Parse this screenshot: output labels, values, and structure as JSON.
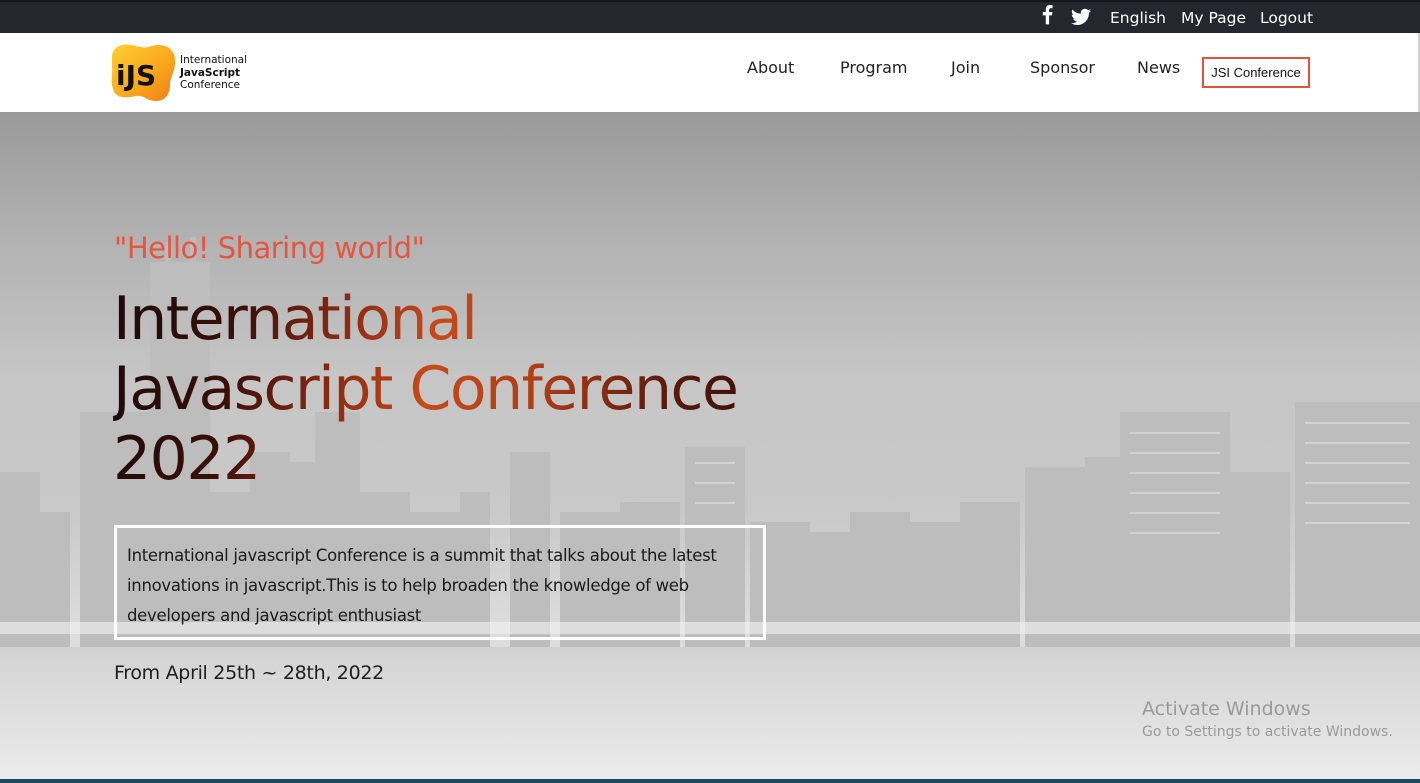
{
  "topbar": {
    "social_icons": [
      "facebook-icon",
      "twitter-icon"
    ],
    "language": "English",
    "my_page": "My Page",
    "logout": "Logout"
  },
  "header": {
    "logo": {
      "mark": "iJS",
      "line1": "International",
      "line2": "JavaScript",
      "line3": "Conference"
    },
    "nav": {
      "about": "About",
      "program": "Program",
      "join": "Join",
      "sponsor": "Sponsor",
      "news": "News",
      "jsi_conference": "JSI Conference"
    }
  },
  "hero": {
    "tagline": "\"Hello! Sharing world\"",
    "title_line1": "International",
    "title_line2": "Javascript Conference",
    "title_line3": "2022",
    "description": "International javascript Conference is a summit that talks about the latest innovations in javascript.This is to help broaden the knowledge of web developers and javascript enthusiast",
    "dates": "From April 25th ~ 28th, 2022"
  },
  "watermark": {
    "line1": "Activate Windows",
    "line2": "Go to Settings to activate Windows."
  },
  "colors": {
    "topbar_bg": "#24272e",
    "accent": "#e8543f",
    "button_border": "#e0533c"
  }
}
